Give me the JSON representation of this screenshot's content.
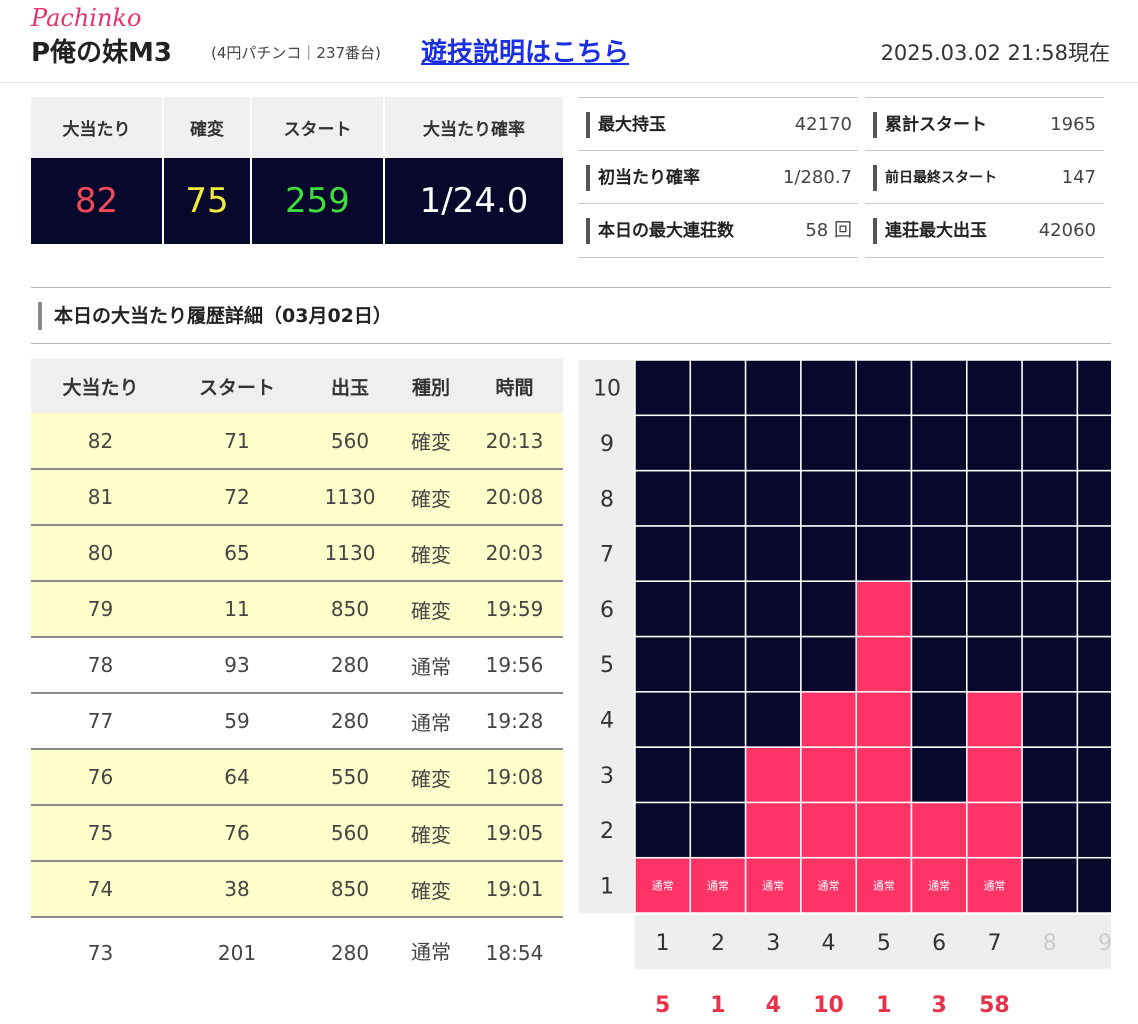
{
  "header": {
    "brand": "Pachinko",
    "title": "P俺の妹M3",
    "subtitle": "(4円パチンコ｜237番台)",
    "help_link": "遊技説明はこちら",
    "timestamp": "2025.03.02 21:58現在"
  },
  "summary": {
    "headers": [
      "大当たり",
      "確変",
      "スタート",
      "大当たり確率"
    ],
    "values": [
      "82",
      "75",
      "259",
      "1/24.0"
    ],
    "colors": [
      "#f04a5a",
      "#f2ec3c",
      "#3fdd3f",
      "#ffffff"
    ]
  },
  "stats": [
    {
      "label": "最大持玉",
      "value": "42170"
    },
    {
      "label": "累計スタート",
      "value": "1965"
    },
    {
      "label": "初当たり確率",
      "value": "1/280.7"
    },
    {
      "label": "前日最終スタート",
      "value": "147"
    },
    {
      "label": "本日の最大連荘数",
      "value": "58 回"
    },
    {
      "label": "連荘最大出玉",
      "value": "42060"
    }
  ],
  "history": {
    "title": "本日の大当たり履歴詳細（03月02日）",
    "headers": [
      "大当たり",
      "スタート",
      "出玉",
      "種別",
      "時間"
    ],
    "rows": [
      [
        "82",
        "71",
        "560",
        "確変",
        "20:13"
      ],
      [
        "81",
        "72",
        "1130",
        "確変",
        "20:08"
      ],
      [
        "80",
        "65",
        "1130",
        "確変",
        "20:03"
      ],
      [
        "79",
        "11",
        "850",
        "確変",
        "19:59"
      ],
      [
        "78",
        "93",
        "280",
        "通常",
        "19:56"
      ],
      [
        "77",
        "59",
        "280",
        "通常",
        "19:28"
      ],
      [
        "76",
        "64",
        "550",
        "確変",
        "19:08"
      ],
      [
        "75",
        "76",
        "560",
        "確変",
        "19:05"
      ],
      [
        "74",
        "38",
        "850",
        "確変",
        "19:01"
      ],
      [
        "73",
        "201",
        "280",
        "通常",
        "18:54"
      ]
    ]
  },
  "chart_data": {
    "type": "heatmap",
    "y_labels": [
      "1",
      "2",
      "3",
      "4",
      "5",
      "6",
      "7",
      "8",
      "9",
      "10"
    ],
    "x_labels": [
      "1",
      "2",
      "3",
      "4",
      "5",
      "6",
      "7",
      "8",
      "9"
    ],
    "column_heights": [
      1,
      1,
      3,
      4,
      6,
      2,
      4,
      0,
      0
    ],
    "base_cell_label": "通常",
    "chain_counts": [
      "5",
      "1",
      "4",
      "10",
      "1",
      "3",
      "58"
    ],
    "colors": {
      "filled": "#ff3366",
      "empty": "#08082c",
      "axis_bg": "#eeeeee",
      "count_text": "#e8324a",
      "inactive_label": "#cccccc"
    }
  }
}
